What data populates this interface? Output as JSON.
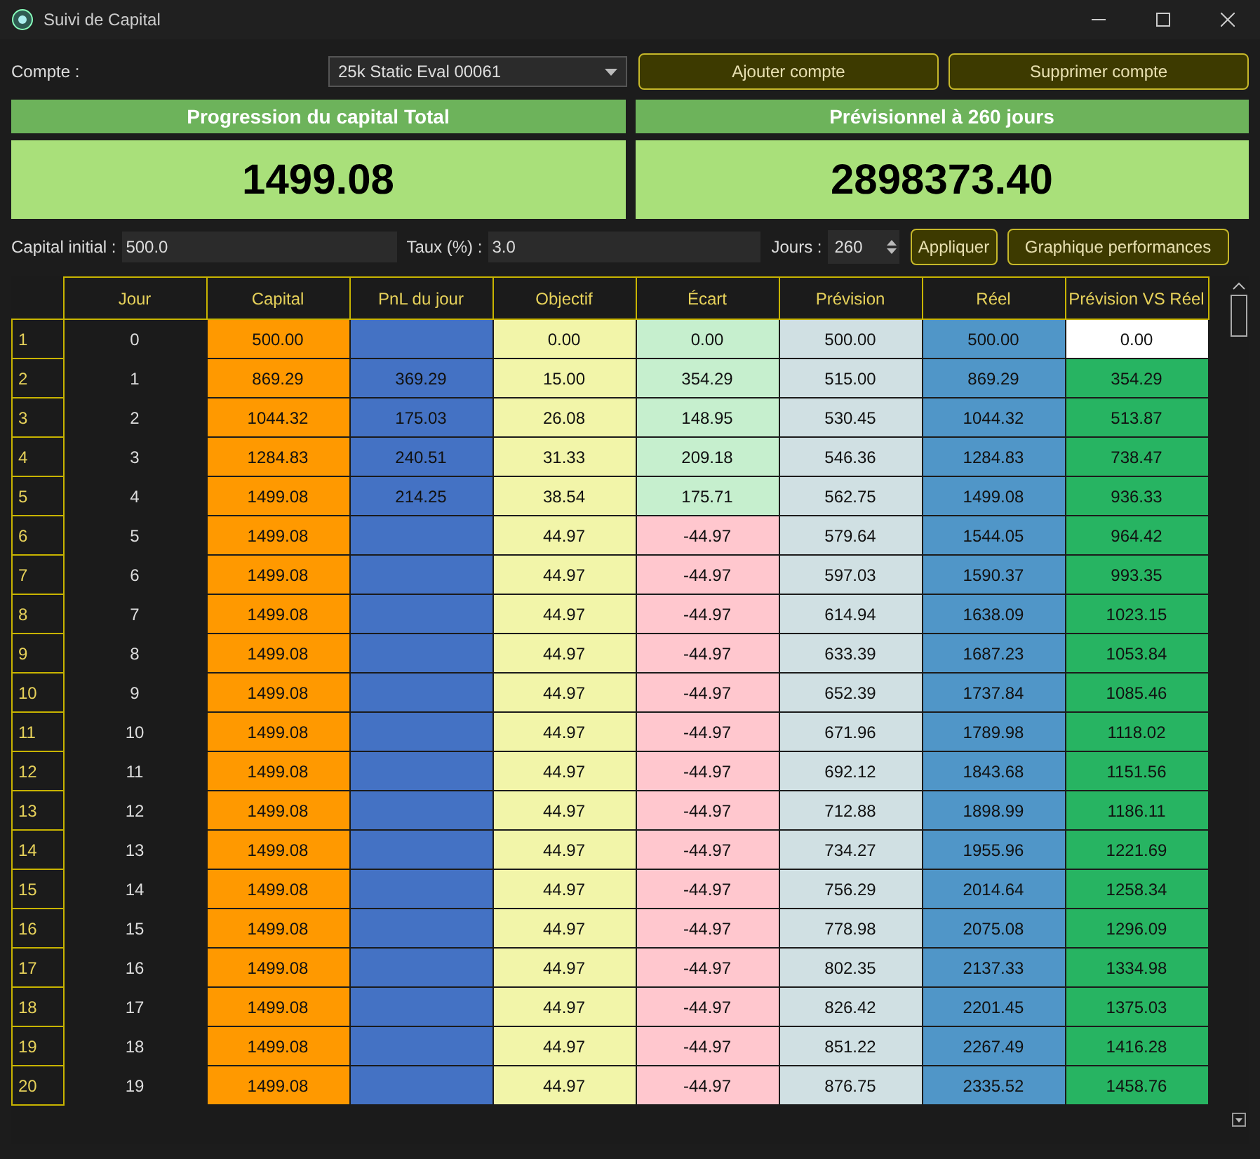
{
  "window": {
    "title": "Suivi de Capital"
  },
  "account": {
    "label": "Compte :",
    "value": "25k Static Eval 00061"
  },
  "buttons": [
    {
      "label": "Ajouter compte"
    },
    {
      "label": "Supprimer compte"
    }
  ],
  "panels": [
    {
      "title": "Progression du capital Total",
      "value": "1499.08"
    },
    {
      "title": "Prévisionnel à 260 jours",
      "value": "2898373.40"
    }
  ],
  "settings": {
    "capital_label": "Capital initial :",
    "capital_value": "500.0",
    "rate_label": "Taux (%) :",
    "rate_value": "3.0",
    "days_label": "Jours :",
    "days_value": "260",
    "apply_button": "Appliquer",
    "chart_button": "Graphique performances"
  },
  "table": {
    "columns": [
      "Jour",
      "Capital",
      "PnL du jour",
      "Objectif",
      "Écart",
      "Prévision",
      "Réel",
      "Prévision VS Réel"
    ],
    "rows": [
      {
        "number": "1",
        "cells": [
          "0",
          "500.00",
          "",
          "0.00",
          "0.00",
          "500.00",
          "500.00",
          "0.00"
        ],
        "negative": false,
        "highlighted": false
      },
      {
        "number": "2",
        "cells": [
          "1",
          "869.29",
          "369.29",
          "15.00",
          "354.29",
          "515.00",
          "869.29",
          "354.29"
        ],
        "negative": false,
        "highlighted": true
      },
      {
        "number": "3",
        "cells": [
          "2",
          "1044.32",
          "175.03",
          "26.08",
          "148.95",
          "530.45",
          "1044.32",
          "513.87"
        ],
        "negative": false,
        "highlighted": true
      },
      {
        "number": "4",
        "cells": [
          "3",
          "1284.83",
          "240.51",
          "31.33",
          "209.18",
          "546.36",
          "1284.83",
          "738.47"
        ],
        "negative": false,
        "highlighted": true
      },
      {
        "number": "5",
        "cells": [
          "4",
          "1499.08",
          "214.25",
          "38.54",
          "175.71",
          "562.75",
          "1499.08",
          "936.33"
        ],
        "negative": false,
        "highlighted": true
      },
      {
        "number": "6",
        "cells": [
          "5",
          "1499.08",
          "",
          "44.97",
          "-44.97",
          "579.64",
          "1544.05",
          "964.42"
        ],
        "negative": true,
        "highlighted": true
      },
      {
        "number": "7",
        "cells": [
          "6",
          "1499.08",
          "",
          "44.97",
          "-44.97",
          "597.03",
          "1590.37",
          "993.35"
        ],
        "negative": true,
        "highlighted": true
      },
      {
        "number": "8",
        "cells": [
          "7",
          "1499.08",
          "",
          "44.97",
          "-44.97",
          "614.94",
          "1638.09",
          "1023.15"
        ],
        "negative": true,
        "highlighted": true
      },
      {
        "number": "9",
        "cells": [
          "8",
          "1499.08",
          "",
          "44.97",
          "-44.97",
          "633.39",
          "1687.23",
          "1053.84"
        ],
        "negative": true,
        "highlighted": true
      },
      {
        "number": "10",
        "cells": [
          "9",
          "1499.08",
          "",
          "44.97",
          "-44.97",
          "652.39",
          "1737.84",
          "1085.46"
        ],
        "negative": true,
        "highlighted": true
      },
      {
        "number": "11",
        "cells": [
          "10",
          "1499.08",
          "",
          "44.97",
          "-44.97",
          "671.96",
          "1789.98",
          "1118.02"
        ],
        "negative": true,
        "highlighted": true
      },
      {
        "number": "12",
        "cells": [
          "11",
          "1499.08",
          "",
          "44.97",
          "-44.97",
          "692.12",
          "1843.68",
          "1151.56"
        ],
        "negative": true,
        "highlighted": true
      },
      {
        "number": "13",
        "cells": [
          "12",
          "1499.08",
          "",
          "44.97",
          "-44.97",
          "712.88",
          "1898.99",
          "1186.11"
        ],
        "negative": true,
        "highlighted": true
      },
      {
        "number": "14",
        "cells": [
          "13",
          "1499.08",
          "",
          "44.97",
          "-44.97",
          "734.27",
          "1955.96",
          "1221.69"
        ],
        "negative": true,
        "highlighted": true
      },
      {
        "number": "15",
        "cells": [
          "14",
          "1499.08",
          "",
          "44.97",
          "-44.97",
          "756.29",
          "2014.64",
          "1258.34"
        ],
        "negative": true,
        "highlighted": true
      },
      {
        "number": "16",
        "cells": [
          "15",
          "1499.08",
          "",
          "44.97",
          "-44.97",
          "778.98",
          "2075.08",
          "1296.09"
        ],
        "negative": true,
        "highlighted": true
      },
      {
        "number": "17",
        "cells": [
          "16",
          "1499.08",
          "",
          "44.97",
          "-44.97",
          "802.35",
          "2137.33",
          "1334.98"
        ],
        "negative": true,
        "highlighted": true
      },
      {
        "number": "18",
        "cells": [
          "17",
          "1499.08",
          "",
          "44.97",
          "-44.97",
          "826.42",
          "2201.45",
          "1375.03"
        ],
        "negative": true,
        "highlighted": true
      },
      {
        "number": "19",
        "cells": [
          "18",
          "1499.08",
          "",
          "44.97",
          "-44.97",
          "851.22",
          "2267.49",
          "1416.28"
        ],
        "negative": true,
        "highlighted": true
      },
      {
        "number": "20",
        "cells": [
          "19",
          "1499.08",
          "",
          "44.97",
          "-44.97",
          "876.75",
          "2335.52",
          "1458.76"
        ],
        "negative": true,
        "highlighted": true
      }
    ]
  }
}
